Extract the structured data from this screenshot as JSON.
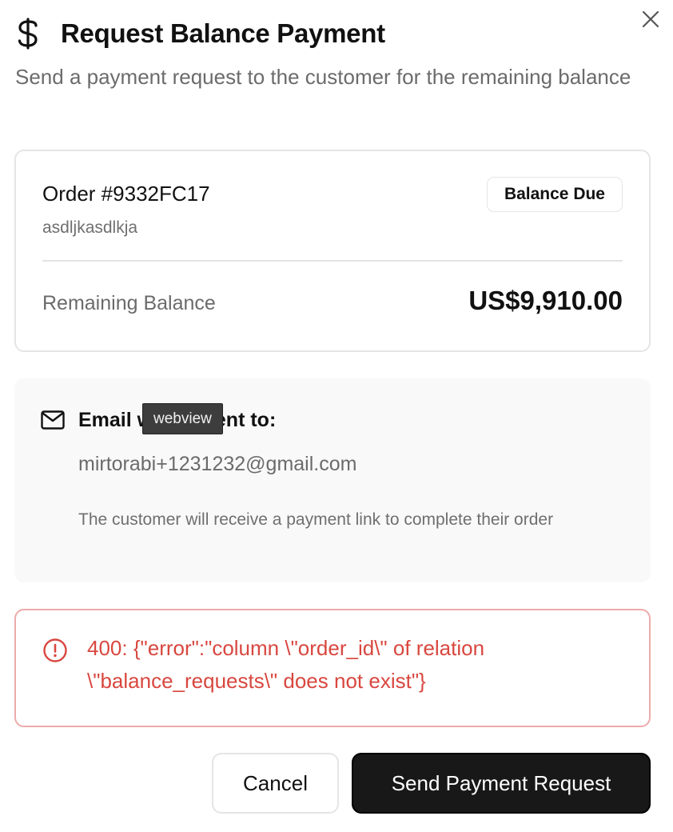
{
  "dialog": {
    "title": "Request Balance Payment",
    "subtitle": "Send a payment request to the customer for the remaining balance",
    "title_icon": "dollar-icon",
    "close_icon": "close-icon"
  },
  "order": {
    "number": "Order #9332FC17",
    "customer": "asdljkasdlkja",
    "badge": "Balance Due",
    "balance_label": "Remaining Balance",
    "balance_amount": "US$9,910.00"
  },
  "email": {
    "icon": "mail-icon",
    "label": "Email will be sent to:",
    "address": "mirtorabi+1231232@gmail.com",
    "note": "The customer will receive a payment link to complete their order"
  },
  "tooltip": {
    "text": "webview"
  },
  "error": {
    "icon": "alert-circle-icon",
    "message": "400: {\"error\":\"column \\\"order_id\\\" of relation \\\"balance_requests\\\" does not exist\"}"
  },
  "actions": {
    "cancel_label": "Cancel",
    "send_label": "Send Payment Request"
  },
  "colors": {
    "primary_button": "#181818",
    "error_text": "#d8473f",
    "error_border": "#eeaaaa",
    "muted_text": "#6b6b6b",
    "email_box_bg": "#f9f9f9"
  }
}
